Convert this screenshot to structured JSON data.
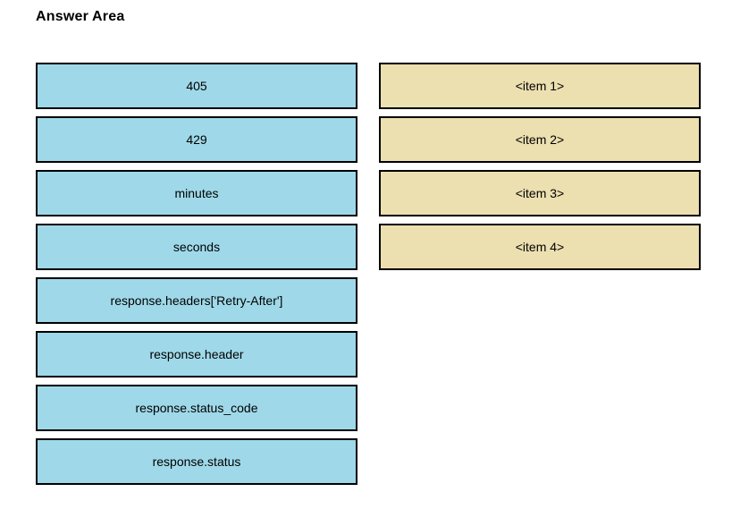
{
  "page": {
    "title": "Answer Area",
    "background_color": "#ffffff"
  },
  "colors": {
    "source_fill": "#9fd9e9",
    "target_fill": "#ecdfb0",
    "border": "#000000",
    "text": "#000000"
  },
  "source_column": {
    "name": "draggable-options",
    "items": [
      {
        "label": "405"
      },
      {
        "label": "429"
      },
      {
        "label": "minutes"
      },
      {
        "label": "seconds"
      },
      {
        "label": "response.headers['Retry-After']"
      },
      {
        "label": "response.header"
      },
      {
        "label": "response.status_code"
      },
      {
        "label": "response.status"
      }
    ]
  },
  "target_column": {
    "name": "drop-targets",
    "items": [
      {
        "label": "<item 1>"
      },
      {
        "label": "<item 2>"
      },
      {
        "label": "<item 3>"
      },
      {
        "label": "<item 4>"
      }
    ]
  }
}
